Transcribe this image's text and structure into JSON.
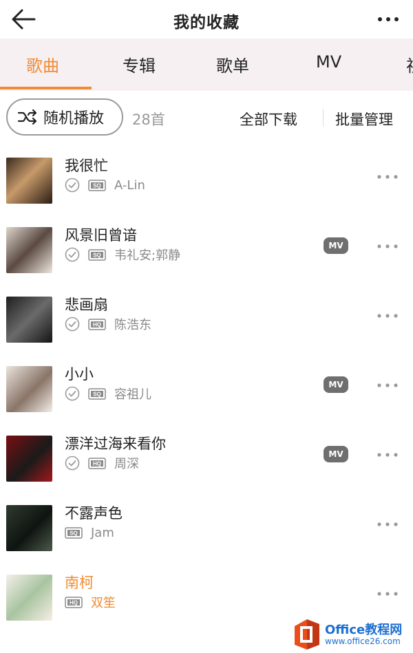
{
  "header": {
    "title": "我的收藏"
  },
  "tabs": [
    {
      "label": "歌曲",
      "active": true
    },
    {
      "label": "专辑",
      "active": false
    },
    {
      "label": "歌单",
      "active": false
    },
    {
      "label": "MV",
      "active": false
    },
    {
      "label": "视",
      "active": false
    }
  ],
  "toolbar": {
    "shuffle_label": "随机播放",
    "count": "28首",
    "download_all": "全部下载",
    "batch_manage": "批量管理"
  },
  "songs": [
    {
      "title": "我很忙",
      "artist": "A-Lin",
      "quality": "SQ",
      "downloaded": true,
      "mv": false,
      "playing": false,
      "mv_label": ""
    },
    {
      "title": "风景旧曾谙",
      "artist": "韦礼安;郭静",
      "quality": "SQ",
      "downloaded": true,
      "mv": true,
      "playing": false,
      "mv_label": "MV"
    },
    {
      "title": "悲画扇",
      "artist": "陈浩东",
      "quality": "HQ",
      "downloaded": true,
      "mv": false,
      "playing": false,
      "mv_label": ""
    },
    {
      "title": "小小",
      "artist": "容祖儿",
      "quality": "SQ",
      "downloaded": true,
      "mv": true,
      "playing": false,
      "mv_label": "MV"
    },
    {
      "title": "漂洋过海来看你",
      "artist": "周深",
      "quality": "HQ",
      "downloaded": true,
      "mv": true,
      "playing": false,
      "mv_label": "MV"
    },
    {
      "title": "不露声色",
      "artist": "Jam",
      "quality": "SQ",
      "downloaded": false,
      "mv": false,
      "playing": false,
      "mv_label": ""
    },
    {
      "title": "南柯",
      "artist": "双笙",
      "quality": "HQ",
      "downloaded": false,
      "mv": false,
      "playing": true,
      "mv_label": ""
    }
  ],
  "watermark": {
    "brand": "Office教程网",
    "url": "www.office26.com"
  },
  "colors": {
    "accent": "#f08c33",
    "tab_bg": "#f6f0f3",
    "mv_badge": "#6f6f6f",
    "watermark": "#1d6fd0"
  }
}
